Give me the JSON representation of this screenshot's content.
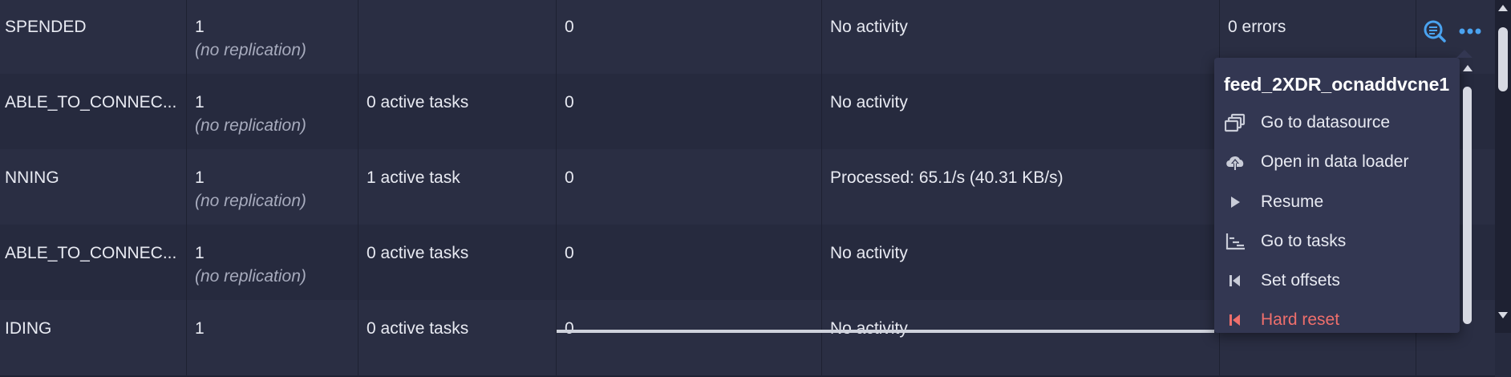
{
  "rows": [
    {
      "status": "SPENDED",
      "replicas": "1",
      "replication": "(no replication)",
      "tasks": "",
      "lag": "0",
      "activity": "No activity",
      "errors": "0 errors"
    },
    {
      "status": "ABLE_TO_CONNEC...",
      "replicas": "1",
      "replication": "(no replication)",
      "tasks": "0 active tasks",
      "lag": "0",
      "activity": "No activity",
      "errors": ""
    },
    {
      "status": "NNING",
      "replicas": "1",
      "replication": "(no replication)",
      "tasks": "1 active task",
      "lag": "0",
      "activity": "Processed: 65.1/s (40.31 KB/s)",
      "errors": ""
    },
    {
      "status": "ABLE_TO_CONNEC...",
      "replicas": "1",
      "replication": "(no replication)",
      "tasks": "0 active tasks",
      "lag": "0",
      "activity": "No activity",
      "errors": ""
    },
    {
      "status": "IDING",
      "replicas": "1",
      "replication": "",
      "tasks": "0 active tasks",
      "lag": "0",
      "activity": "No activity",
      "errors": ""
    }
  ],
  "menu": {
    "title": "feed_2XDR_ocnaddvcne1",
    "items": [
      {
        "label": "Go to datasource",
        "icon": "datasource-icon"
      },
      {
        "label": "Open in data loader",
        "icon": "cloud-upload-icon"
      },
      {
        "label": "Resume",
        "icon": "play-icon"
      },
      {
        "label": "Go to tasks",
        "icon": "tasks-icon"
      },
      {
        "label": "Set offsets",
        "icon": "skip-back-icon"
      },
      {
        "label": "Hard reset",
        "icon": "hard-reset-icon"
      }
    ]
  },
  "colors": {
    "accent": "#4aa3f0",
    "danger": "#ef6f6c",
    "background": "#262a3e"
  }
}
